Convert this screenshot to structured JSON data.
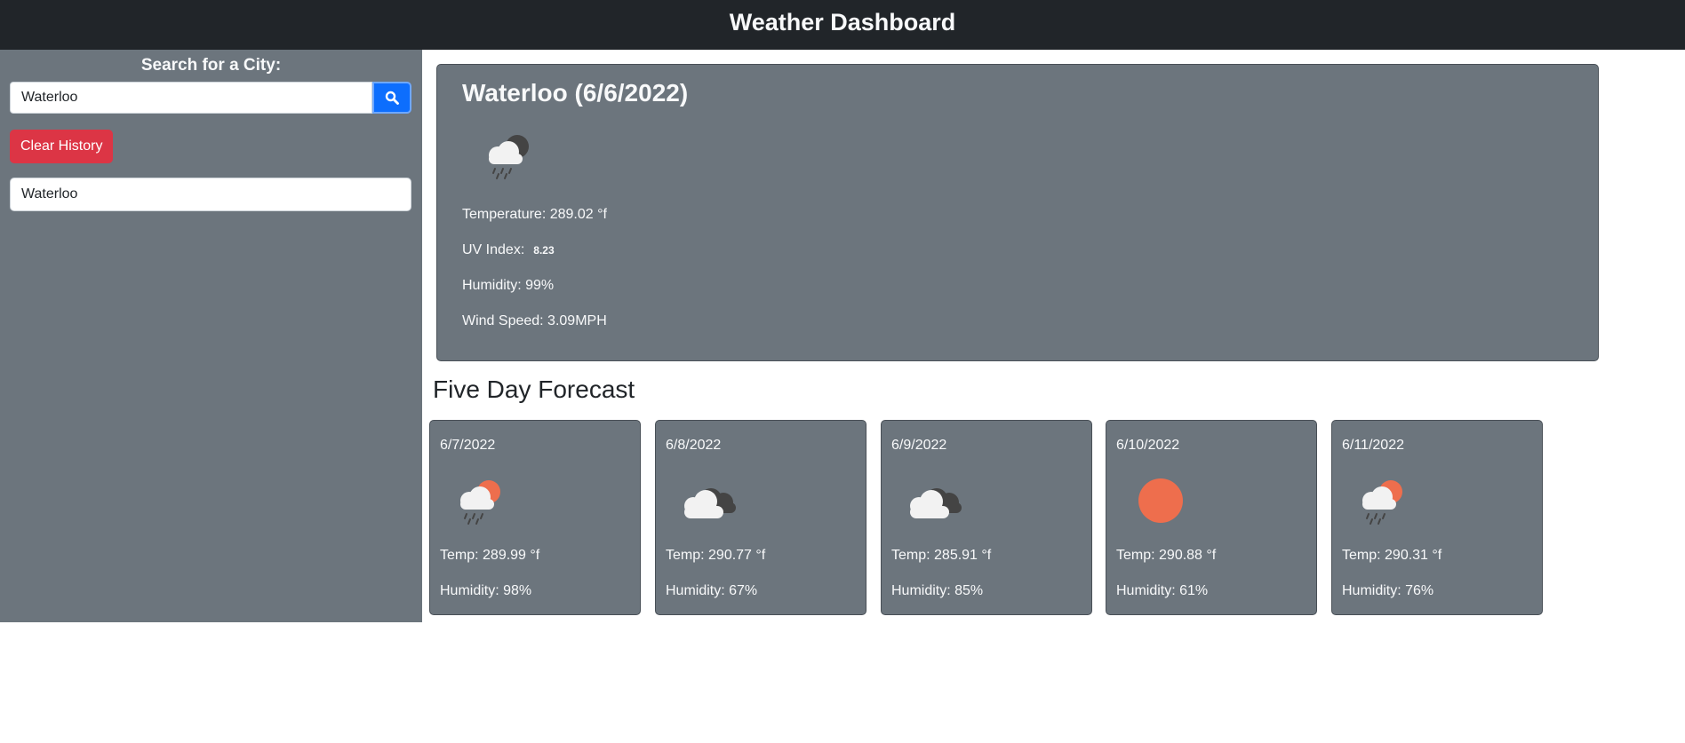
{
  "header": {
    "title": "Weather Dashboard"
  },
  "sidebar": {
    "search_label": "Search for a City:",
    "search_value": "Waterloo",
    "search_icon": "search-icon",
    "clear_label": "Clear History",
    "history": [
      "Waterloo"
    ]
  },
  "current": {
    "title": "Waterloo (6/6/2022)",
    "icon": "rain-cloud-night-icon",
    "temperature": "Temperature: 289.02 °f",
    "uv_label": "UV Index:",
    "uv_value": "8.23",
    "humidity": "Humidity: 99%",
    "wind": "Wind Speed: 3.09MPH"
  },
  "forecast": {
    "heading": "Five Day Forecast",
    "days": [
      {
        "date": "6/7/2022",
        "icon": "rain-cloud-sun-icon",
        "temp": "Temp: 289.99 °f",
        "humidity": "Humidity: 98%"
      },
      {
        "date": "6/8/2022",
        "icon": "broken-clouds-icon",
        "temp": "Temp: 290.77 °f",
        "humidity": "Humidity: 67%"
      },
      {
        "date": "6/9/2022",
        "icon": "broken-clouds-icon",
        "temp": "Temp: 285.91 °f",
        "humidity": "Humidity: 85%"
      },
      {
        "date": "6/10/2022",
        "icon": "clear-sun-icon",
        "temp": "Temp: 290.88 °f",
        "humidity": "Humidity: 61%"
      },
      {
        "date": "6/11/2022",
        "icon": "rain-cloud-sun-icon",
        "temp": "Temp: 290.31 °f",
        "humidity": "Humidity: 76%"
      }
    ]
  },
  "colors": {
    "header_bg": "#212529",
    "panel_bg": "#6c757d",
    "primary": "#0d6efd",
    "danger": "#dc3545",
    "sun": "#ee6e4d",
    "cloud": "#f2f2f2",
    "dark_cloud": "#444444"
  }
}
